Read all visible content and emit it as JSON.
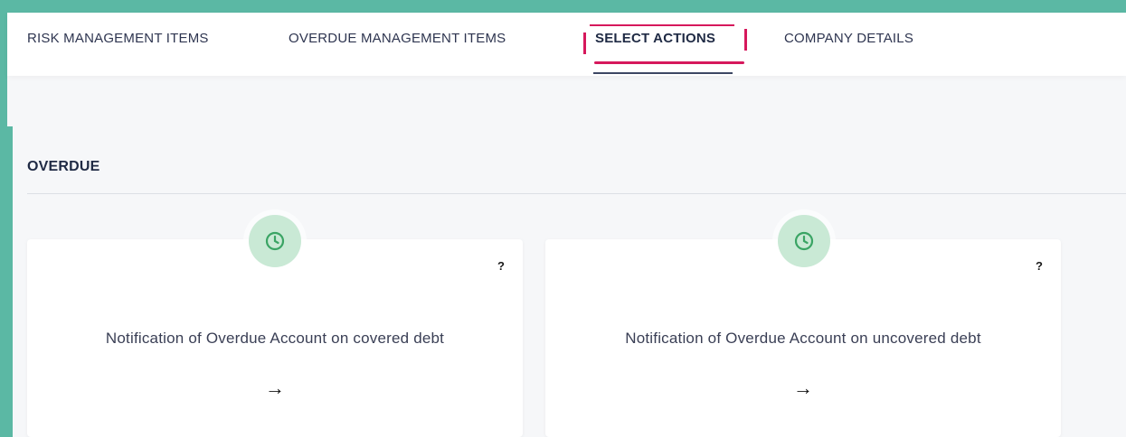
{
  "tabs": [
    {
      "label": "RISK MANAGEMENT ITEMS"
    },
    {
      "label": "OVERDUE MANAGEMENT ITEMS"
    },
    {
      "label": "SELECT ACTIONS"
    },
    {
      "label": "COMPANY DETAILS"
    }
  ],
  "active_tab": "SELECT ACTIONS",
  "section": {
    "title": "OVERDUE"
  },
  "cards": [
    {
      "title": "Notification of Overdue Account on covered debt",
      "help": "?",
      "arrow": "→",
      "icon": "clock-icon"
    },
    {
      "title": "Notification of Overdue Account on uncovered debt",
      "help": "?",
      "arrow": "→",
      "icon": "clock-icon"
    }
  ],
  "colors": {
    "frame": "#5bb8a4",
    "highlight": "#d6185c",
    "icon_bubble": "#c9e9d5",
    "icon_stroke": "#3aa464",
    "text_dark": "#1f2a44"
  }
}
